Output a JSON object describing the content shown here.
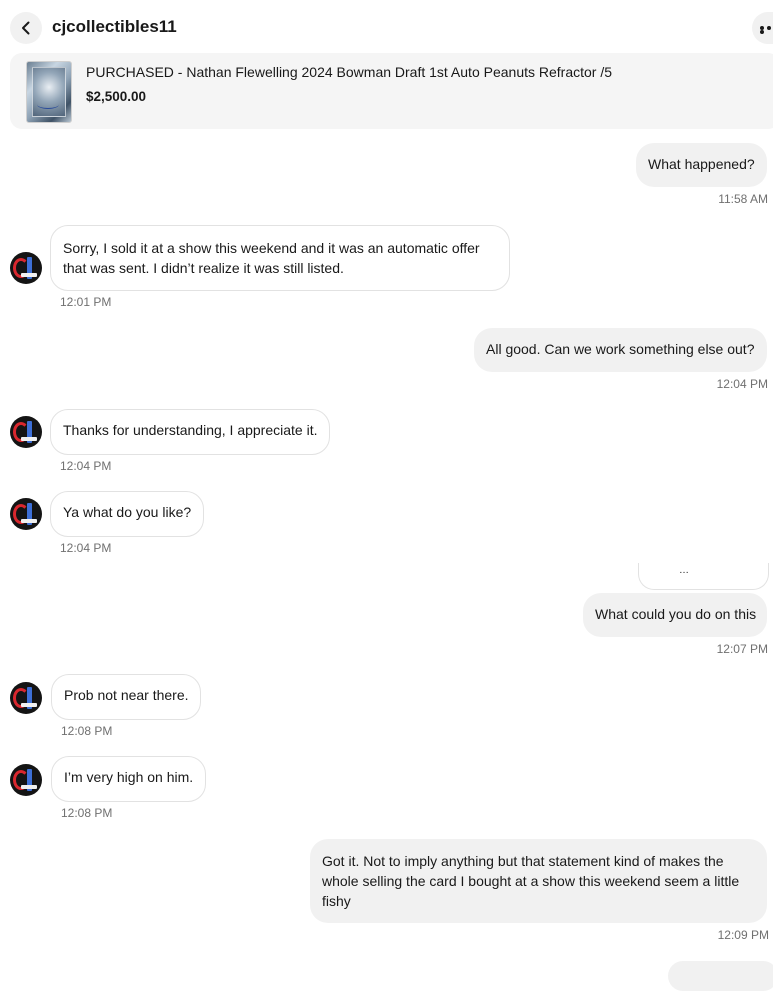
{
  "header": {
    "title": "cjcollectibles11",
    "back_icon": "chevron-left-icon",
    "more_icon": "more-horizontal-icon"
  },
  "listing": {
    "title": "PURCHASED - Nathan Flewelling 2024 Bowman Draft 1st Auto Peanuts Refractor /5",
    "price": "$2,500.00"
  },
  "messages": [
    {
      "from": "me",
      "text": "What happened?",
      "time": "11:58 AM"
    },
    {
      "from": "seller",
      "lines": [
        "Sorry, I sold it at a show this weekend and it was an automatic offer",
        "that was sent. I didn’t realize it was still listed."
      ],
      "time": "12:01 PM"
    },
    {
      "from": "me",
      "text": "All good. Can we work something else out?",
      "time": "12:04 PM"
    },
    {
      "from": "seller",
      "text": "Thanks for understanding, I appreciate it.",
      "time": "12:04 PM"
    },
    {
      "from": "seller",
      "text": "Ya what do you like?",
      "time": "12:04 PM"
    },
    {
      "from": "me",
      "text": "…"
    },
    {
      "from": "me",
      "text": "What could you do on this",
      "time": "12:07 PM"
    },
    {
      "from": "seller",
      "text": "Prob not near there.",
      "time": "12:08 PM"
    },
    {
      "from": "seller",
      "text": "I’m very high on him.",
      "time": "12:08 PM"
    },
    {
      "from": "me",
      "lines": [
        "Got it. Not to imply anything but that statement kind of makes the",
        "whole selling the card I bought at a show this weekend seem a little",
        "fishy"
      ],
      "time": "12:09 PM"
    }
  ],
  "colors": {
    "outgoing_bubble": "#f1f1f1",
    "incoming_border": "#e2e2e2",
    "timestamp": "#707070",
    "avatar_red": "#d9272e",
    "avatar_blue": "#3d6fd6"
  }
}
